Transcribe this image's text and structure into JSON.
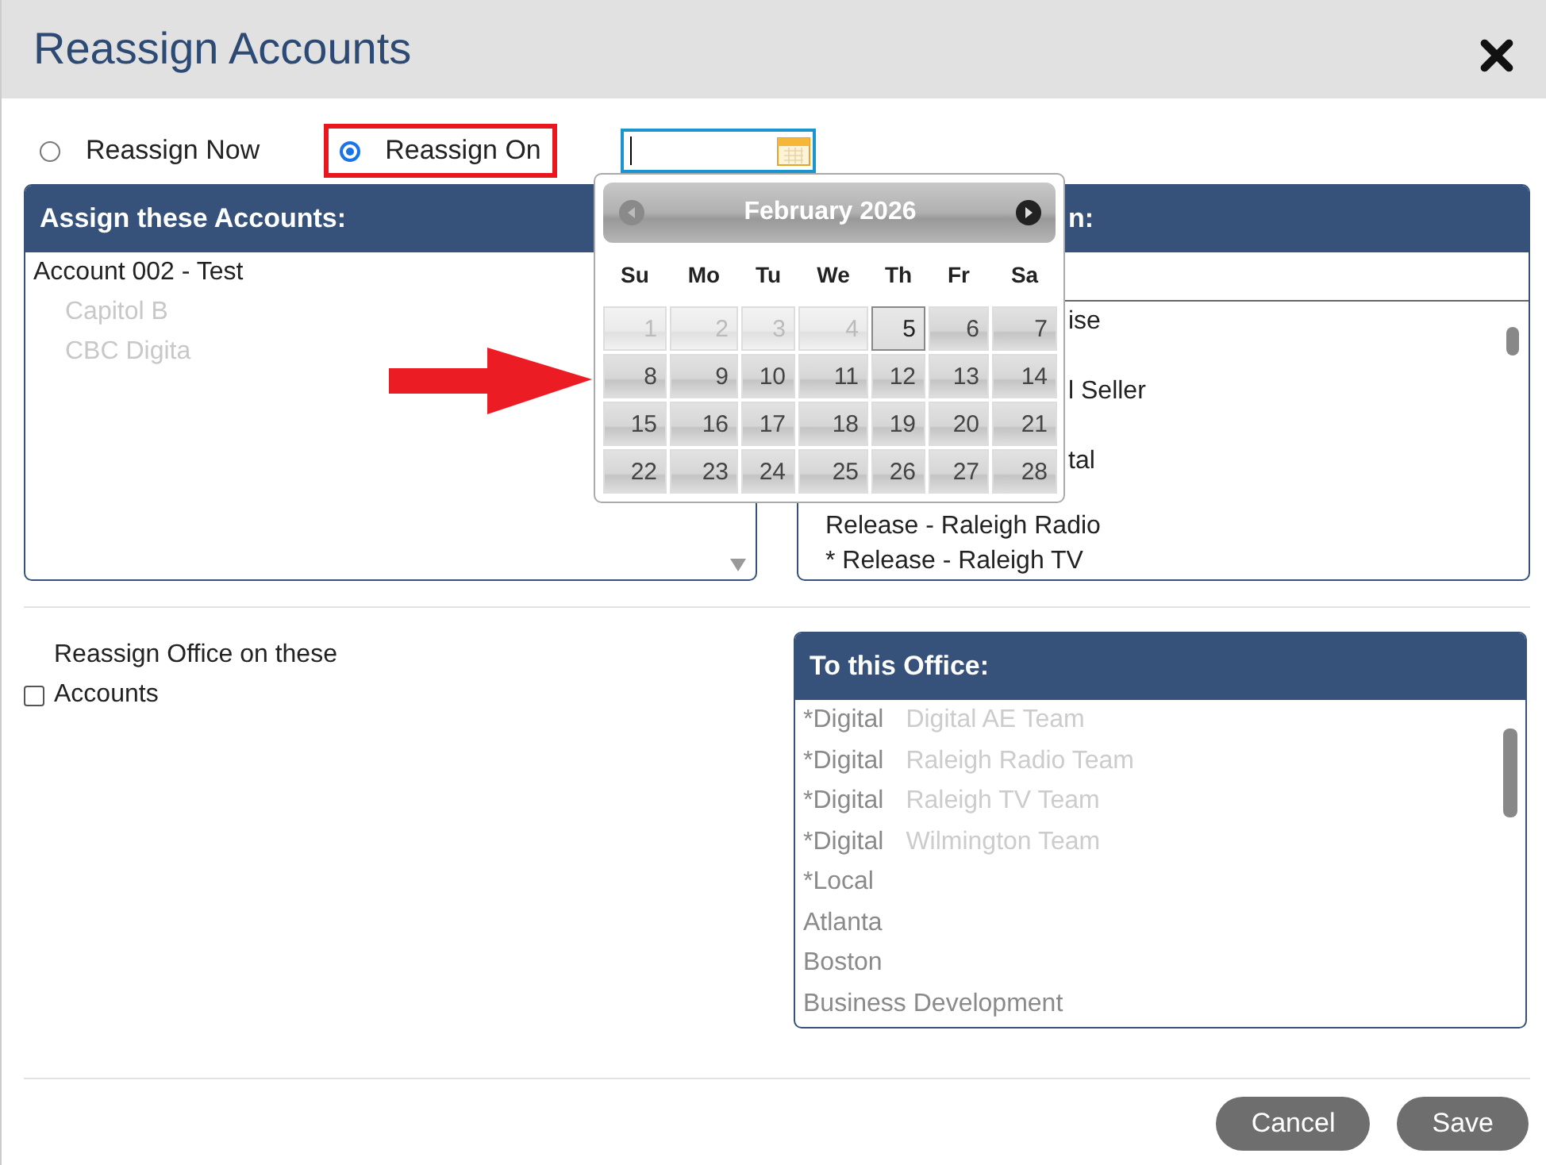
{
  "window": {
    "title": "Reassign Accounts"
  },
  "timing": [
    {
      "label": "Reassign Now",
      "selected": false,
      "highlighted": false
    },
    {
      "label": "Reassign On",
      "selected": true,
      "highlighted": true
    }
  ],
  "calendar": {
    "title": "February 2026",
    "weekdays": [
      "Su",
      "Mo",
      "Tu",
      "We",
      "Th",
      "Fr",
      "Sa"
    ],
    "days": [
      {
        "label": "1",
        "disabled": true,
        "selected": false
      },
      {
        "label": "2",
        "disabled": true,
        "selected": false
      },
      {
        "label": "3",
        "disabled": true,
        "selected": false
      },
      {
        "label": "4",
        "disabled": true,
        "selected": false
      },
      {
        "label": "5",
        "disabled": false,
        "selected": true
      },
      {
        "label": "6",
        "disabled": false,
        "selected": false
      },
      {
        "label": "7",
        "disabled": false,
        "selected": false
      },
      {
        "label": "8",
        "disabled": false,
        "selected": false
      },
      {
        "label": "9",
        "disabled": false,
        "selected": false
      },
      {
        "label": "10",
        "disabled": false,
        "selected": false
      },
      {
        "label": "11",
        "disabled": false,
        "selected": false
      },
      {
        "label": "12",
        "disabled": false,
        "selected": false
      },
      {
        "label": "13",
        "disabled": false,
        "selected": false
      },
      {
        "label": "14",
        "disabled": false,
        "selected": false
      },
      {
        "label": "15",
        "disabled": false,
        "selected": false
      },
      {
        "label": "16",
        "disabled": false,
        "selected": false
      },
      {
        "label": "17",
        "disabled": false,
        "selected": false
      },
      {
        "label": "18",
        "disabled": false,
        "selected": false
      },
      {
        "label": "19",
        "disabled": false,
        "selected": false
      },
      {
        "label": "20",
        "disabled": false,
        "selected": false
      },
      {
        "label": "21",
        "disabled": false,
        "selected": false
      },
      {
        "label": "22",
        "disabled": false,
        "selected": false
      },
      {
        "label": "23",
        "disabled": false,
        "selected": false
      },
      {
        "label": "24",
        "disabled": false,
        "selected": false
      },
      {
        "label": "25",
        "disabled": false,
        "selected": false
      },
      {
        "label": "26",
        "disabled": false,
        "selected": false
      },
      {
        "label": "27",
        "disabled": false,
        "selected": false
      },
      {
        "label": "28",
        "disabled": false,
        "selected": false
      }
    ]
  },
  "accounts_panel": {
    "header": "Assign these Accounts:",
    "items": [
      {
        "text": "Account 002 - Test",
        "kind": "normal"
      },
      {
        "text": "Capitol B",
        "kind": "faded"
      },
      {
        "text": "CBC Digita",
        "kind": "faded"
      }
    ]
  },
  "to_panel": {
    "header": "n:",
    "items": [
      {
        "text": "ise",
        "kind": "partial"
      },
      {
        "text": "l Seller",
        "kind": "partial"
      },
      {
        "text": "tal",
        "kind": "partial"
      },
      {
        "text": "Release - Raleigh Radio",
        "kind": "normal"
      },
      {
        "text": "* Release - Raleigh TV",
        "kind": "normal"
      }
    ]
  },
  "office_option": {
    "label": "Reassign Office on these Accounts",
    "checked": false
  },
  "office_panel": {
    "header": "To this Office:",
    "items": [
      {
        "text": "*Digital",
        "detail": "Digital AE Team"
      },
      {
        "text": "*Digital",
        "detail": "Raleigh Radio Team"
      },
      {
        "text": "*Digital",
        "detail": "Raleigh TV Team"
      },
      {
        "text": "*Digital",
        "detail": "Wilmington Team"
      },
      {
        "text": "*Local"
      },
      {
        "text": "Atlanta"
      },
      {
        "text": "Boston"
      },
      {
        "text": "Business Development"
      }
    ]
  },
  "buttons": [
    {
      "label": "Cancel"
    },
    {
      "label": "Save"
    }
  ]
}
